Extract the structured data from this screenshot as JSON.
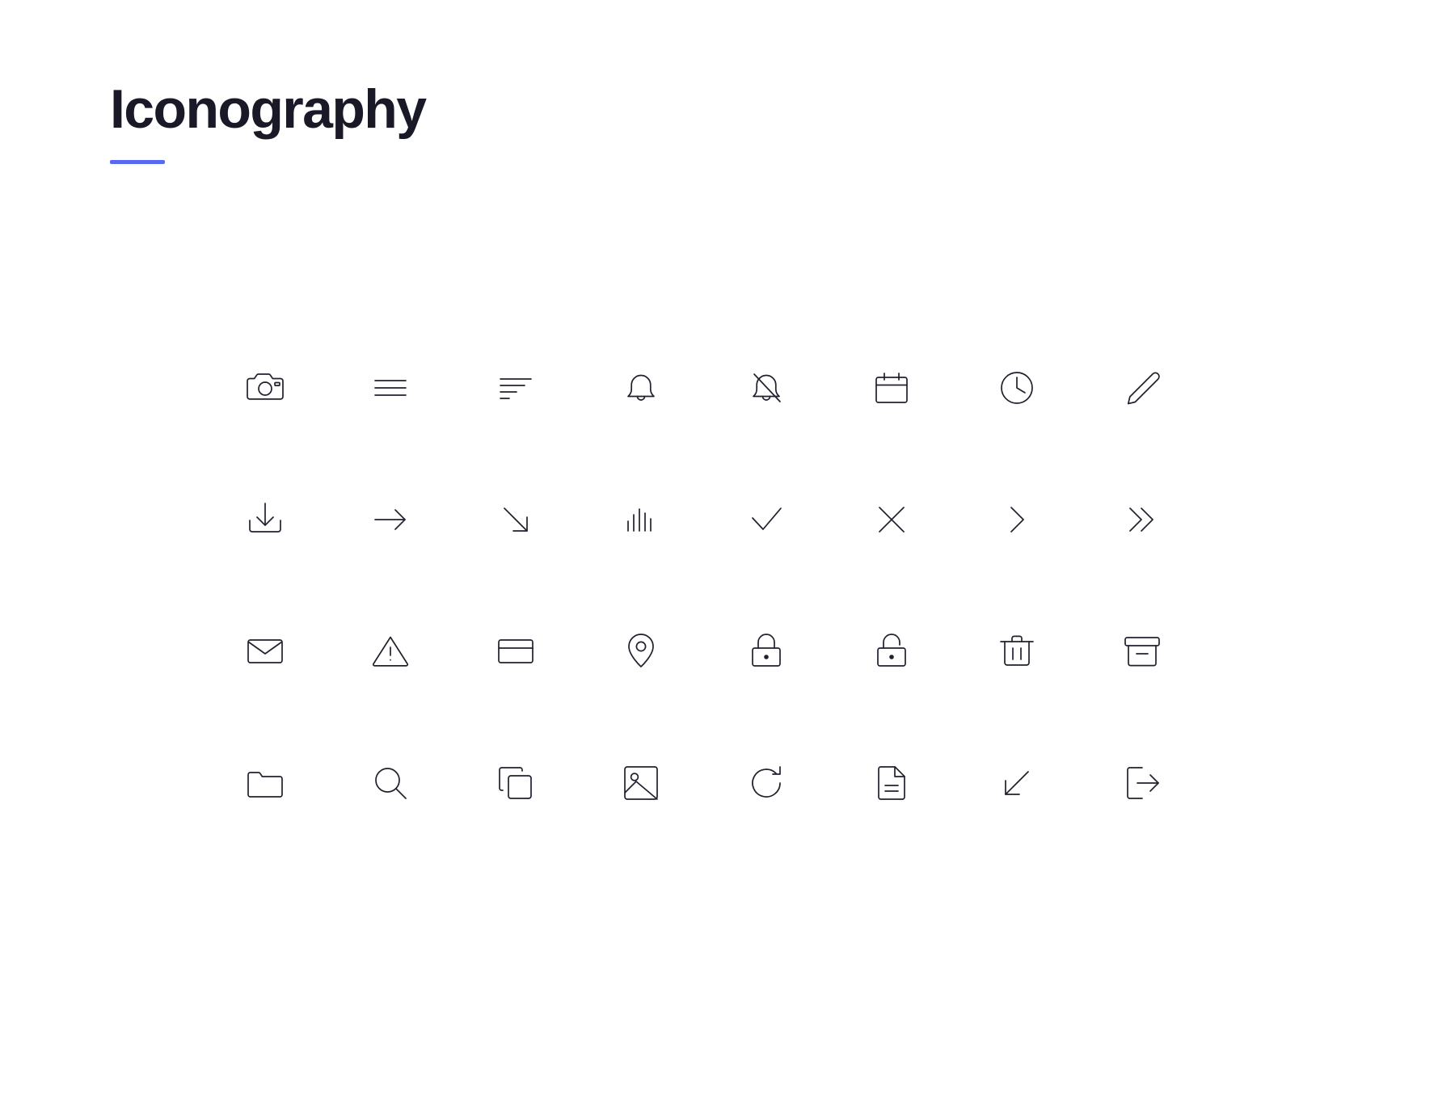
{
  "page": {
    "title": "Iconography",
    "background_color": "#ffffff",
    "title_color": "#191928",
    "accent_color": "#5869f2",
    "icon_stroke_color": "#20202e"
  },
  "icon_grid": {
    "columns": 8,
    "rows": 4,
    "icons": [
      {
        "name": "camera-icon",
        "label": "Camera"
      },
      {
        "name": "menu-icon",
        "label": "Menu"
      },
      {
        "name": "sort-icon",
        "label": "Sort"
      },
      {
        "name": "bell-icon",
        "label": "Notifications"
      },
      {
        "name": "bell-off-icon",
        "label": "Notifications Off"
      },
      {
        "name": "calendar-icon",
        "label": "Calendar"
      },
      {
        "name": "clock-icon",
        "label": "Clock"
      },
      {
        "name": "pencil-icon",
        "label": "Edit"
      },
      {
        "name": "download-icon",
        "label": "Download"
      },
      {
        "name": "arrow-right-icon",
        "label": "Arrow Right"
      },
      {
        "name": "arrow-down-right-icon",
        "label": "Arrow Down Right"
      },
      {
        "name": "bar-chart-icon",
        "label": "Bar Chart"
      },
      {
        "name": "check-icon",
        "label": "Check"
      },
      {
        "name": "close-icon",
        "label": "Close"
      },
      {
        "name": "chevron-right-icon",
        "label": "Chevron Right"
      },
      {
        "name": "chevrons-right-icon",
        "label": "Chevrons Right"
      },
      {
        "name": "mail-icon",
        "label": "Mail"
      },
      {
        "name": "alert-triangle-icon",
        "label": "Warning"
      },
      {
        "name": "credit-card-icon",
        "label": "Credit Card"
      },
      {
        "name": "map-pin-icon",
        "label": "Location"
      },
      {
        "name": "lock-icon",
        "label": "Locked"
      },
      {
        "name": "unlock-icon",
        "label": "Unlocked"
      },
      {
        "name": "trash-icon",
        "label": "Delete"
      },
      {
        "name": "archive-icon",
        "label": "Archive"
      },
      {
        "name": "folder-icon",
        "label": "Folder"
      },
      {
        "name": "search-icon",
        "label": "Search"
      },
      {
        "name": "copy-icon",
        "label": "Copy"
      },
      {
        "name": "image-icon",
        "label": "Image"
      },
      {
        "name": "refresh-icon",
        "label": "Refresh"
      },
      {
        "name": "file-text-icon",
        "label": "Document"
      },
      {
        "name": "arrow-down-left-icon",
        "label": "Arrow Down Left"
      },
      {
        "name": "logout-icon",
        "label": "Log Out"
      }
    ]
  }
}
